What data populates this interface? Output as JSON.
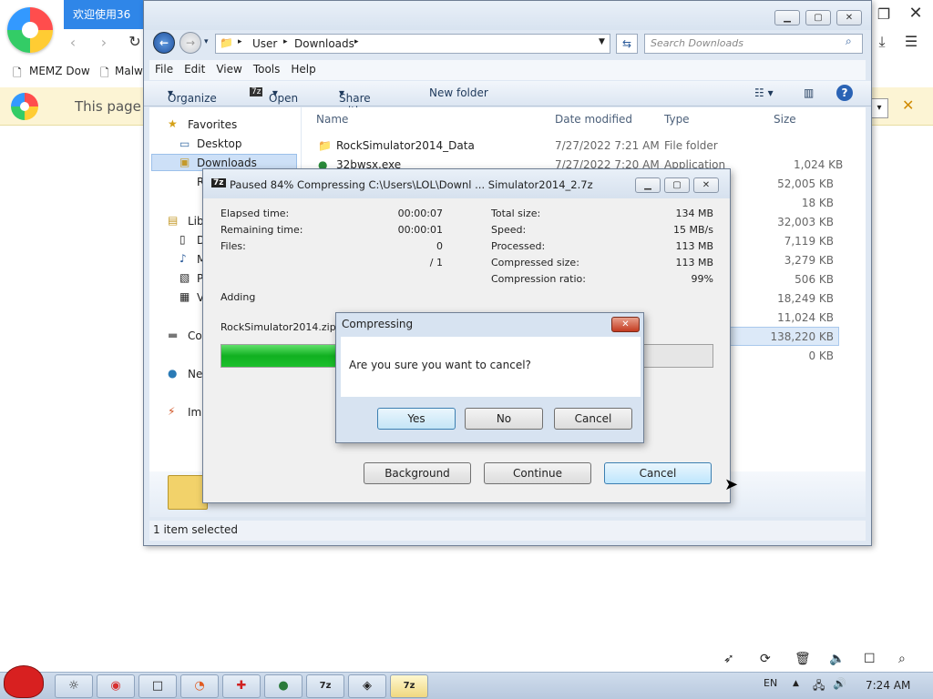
{
  "browser": {
    "tab_title": "欢迎使用36",
    "bookmarks": [
      "MEMZ Dow",
      "Malw"
    ],
    "infobar_text": "This page is"
  },
  "explorer": {
    "breadcrumb": [
      "User",
      "Downloads"
    ],
    "search_placeholder": "Search Downloads",
    "menu": [
      "File",
      "Edit",
      "View",
      "Tools",
      "Help"
    ],
    "commands": {
      "organize": "Organize",
      "open": "Open",
      "share": "Share with",
      "new_folder": "New folder"
    },
    "nav": {
      "favorites": "Favorites",
      "desktop": "Desktop",
      "downloads": "Downloads",
      "recent": "R",
      "libraries": "Lib",
      "lib_docs": "D",
      "lib_music": "M",
      "lib_pictures": "P",
      "lib_videos": "V",
      "computer": "Co",
      "network": "Ne",
      "image": "Ima"
    },
    "columns": {
      "name": "Name",
      "date": "Date modified",
      "type": "Type",
      "size": "Size"
    },
    "rows": [
      {
        "name": "RockSimulator2014_Data",
        "date": "7/27/2022 7:21 AM",
        "type": "File folder",
        "size": ""
      },
      {
        "name": "32bwsx.exe",
        "date": "7/27/2022 7:20 AM",
        "type": "Application",
        "size": "1,024 KB"
      }
    ],
    "extra_sizes": [
      "52,005 KB",
      "18 KB",
      "32,003 KB",
      "7,119 KB",
      "3,279 KB",
      "506 KB",
      "18,249 KB",
      "11,024 KB",
      "138,220 KB",
      "0 KB"
    ],
    "status": "1 item selected"
  },
  "sevenzip": {
    "title": "Paused 84% Compressing C:\\Users\\LOL\\Downl ... Simulator2014_2.7z",
    "elapsed_label": "Elapsed time:",
    "elapsed": "00:00:07",
    "remaining_label": "Remaining time:",
    "remaining": "00:00:01",
    "files_label": "Files:",
    "files": "0",
    "files_total": "/ 1",
    "total_size_label": "Total size:",
    "total_size": "134 MB",
    "speed_label": "Speed:",
    "speed": "15 MB/s",
    "processed_label": "Processed:",
    "processed": "113 MB",
    "compressed_label": "Compressed size:",
    "compressed": "113 MB",
    "ratio_label": "Compression ratio:",
    "ratio": "99%",
    "action": "Adding",
    "current_file": "RockSimulator2014.zip",
    "progress": 0.84,
    "buttons": {
      "background": "Background",
      "continue": "Continue",
      "cancel": "Cancel"
    }
  },
  "dialog": {
    "title": "Compressing",
    "message": "Are you sure you want to cancel?",
    "yes": "Yes",
    "no": "No",
    "cancel": "Cancel"
  },
  "taskbar": {
    "lang": "EN",
    "time": "7:24 AM"
  }
}
